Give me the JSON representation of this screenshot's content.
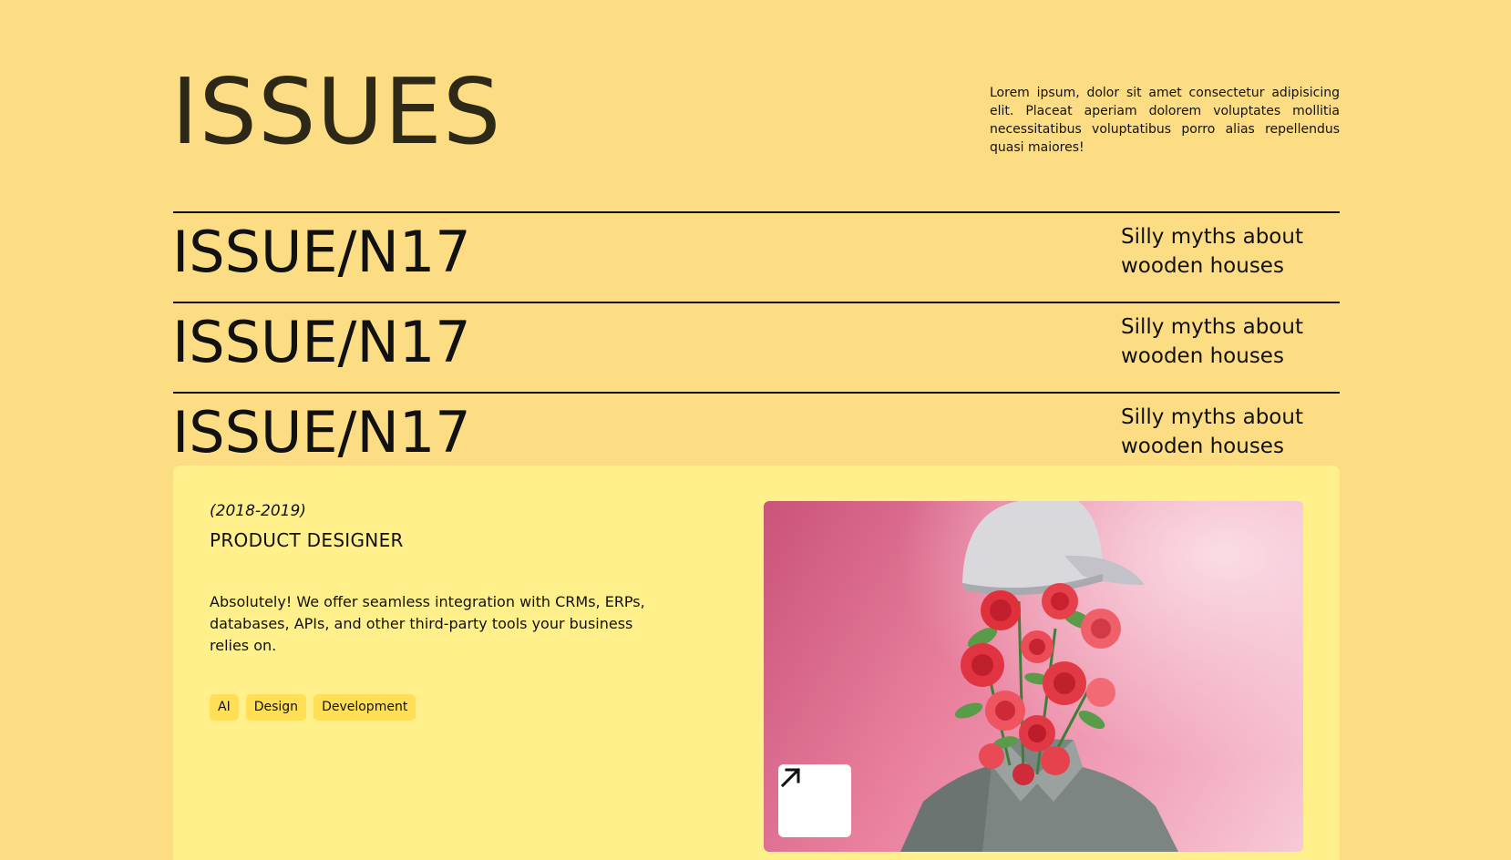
{
  "header": {
    "title": "ISSUES",
    "description": "Lorem ipsum, dolor sit amet consectetur adipisicing elit. Placeat aperiam dolorem voluptates mollitia necessitatibus voluptatibus porro alias repellendus quasi maiores!"
  },
  "issues": [
    {
      "number": "ISSUE/N17",
      "subtitle": "Silly myths about wooden houses"
    },
    {
      "number": "ISSUE/N17",
      "subtitle": "Silly myths about wooden houses"
    },
    {
      "number": "ISSUE/N17",
      "subtitle": "Silly myths about wooden houses"
    }
  ],
  "card": {
    "period": "(2018-2019)",
    "role": "PRODUCT DESIGNER",
    "description": "Absolutely! We offer seamless integration with CRMs, ERPs, databases, APIs, and other third-party tools your business relies on.",
    "tags": [
      "AI",
      "Design",
      "Development"
    ],
    "image_icon": "arrow-up-right-icon"
  },
  "colors": {
    "background": "#fddd84",
    "card_background": "#fff08c",
    "tag_background": "#ffdf55",
    "title_color": "#2e2917"
  }
}
